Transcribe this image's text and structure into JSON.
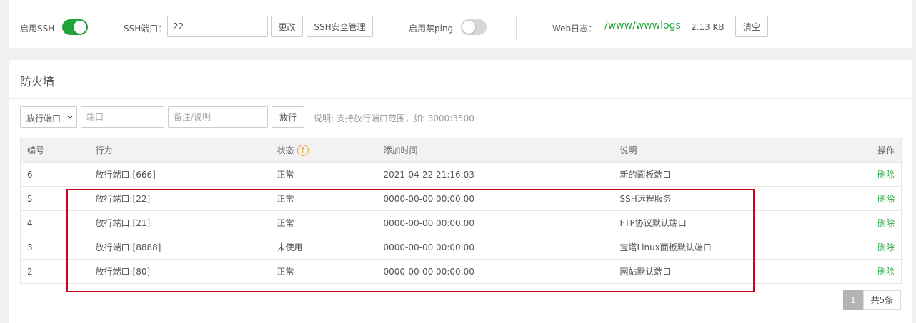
{
  "ssh": {
    "enable_label": "启用SSH",
    "enabled": true,
    "port_label": "SSH端口：",
    "port_value": "22",
    "change_button": "更改",
    "manage_button": "SSH安全管理"
  },
  "ping": {
    "label": "启用禁ping",
    "enabled": false
  },
  "weblog": {
    "label": "Web日志：",
    "path": "/www/wwwlogs",
    "size": "2.13 KB",
    "clear_button": "清空"
  },
  "firewall": {
    "title": "防火墙",
    "type_select": "放行端口",
    "port_placeholder": "端口",
    "note_placeholder": "备注/说明",
    "add_button": "放行",
    "hint": "说明: 支持放行端口范围，如: 3000:3500",
    "columns": {
      "id": "编号",
      "action": "行为",
      "status": "状态",
      "added": "添加时间",
      "note": "说明",
      "op": "操作"
    },
    "rows": [
      {
        "id": "6",
        "action": "放行端口:[666]",
        "status": "正常",
        "added": "2021-04-22 21:16:03",
        "note": "新的面板端口",
        "op": "删除"
      },
      {
        "id": "5",
        "action": "放行端口:[22]",
        "status": "正常",
        "added": "0000-00-00 00:00:00",
        "note": "SSH远程服务",
        "op": "删除"
      },
      {
        "id": "4",
        "action": "放行端口:[21]",
        "status": "正常",
        "added": "0000-00-00 00:00:00",
        "note": "FTP协议默认端口",
        "op": "删除"
      },
      {
        "id": "3",
        "action": "放行端口:[8888]",
        "status": "未使用",
        "added": "0000-00-00 00:00:00",
        "note": "宝塔Linux面板默认端口",
        "op": "删除"
      },
      {
        "id": "2",
        "action": "放行端口:[80]",
        "status": "正常",
        "added": "0000-00-00 00:00:00",
        "note": "网站默认端口",
        "op": "删除"
      }
    ]
  },
  "pagination": {
    "current": "1",
    "total": "共5条"
  },
  "icons": {
    "status_help": "question-circle-icon",
    "select_arrow": "chevron-down-icon"
  },
  "colors": {
    "accent": "#20a53a",
    "highlight": "#d0021b",
    "help_icon": "#f0a22c"
  }
}
